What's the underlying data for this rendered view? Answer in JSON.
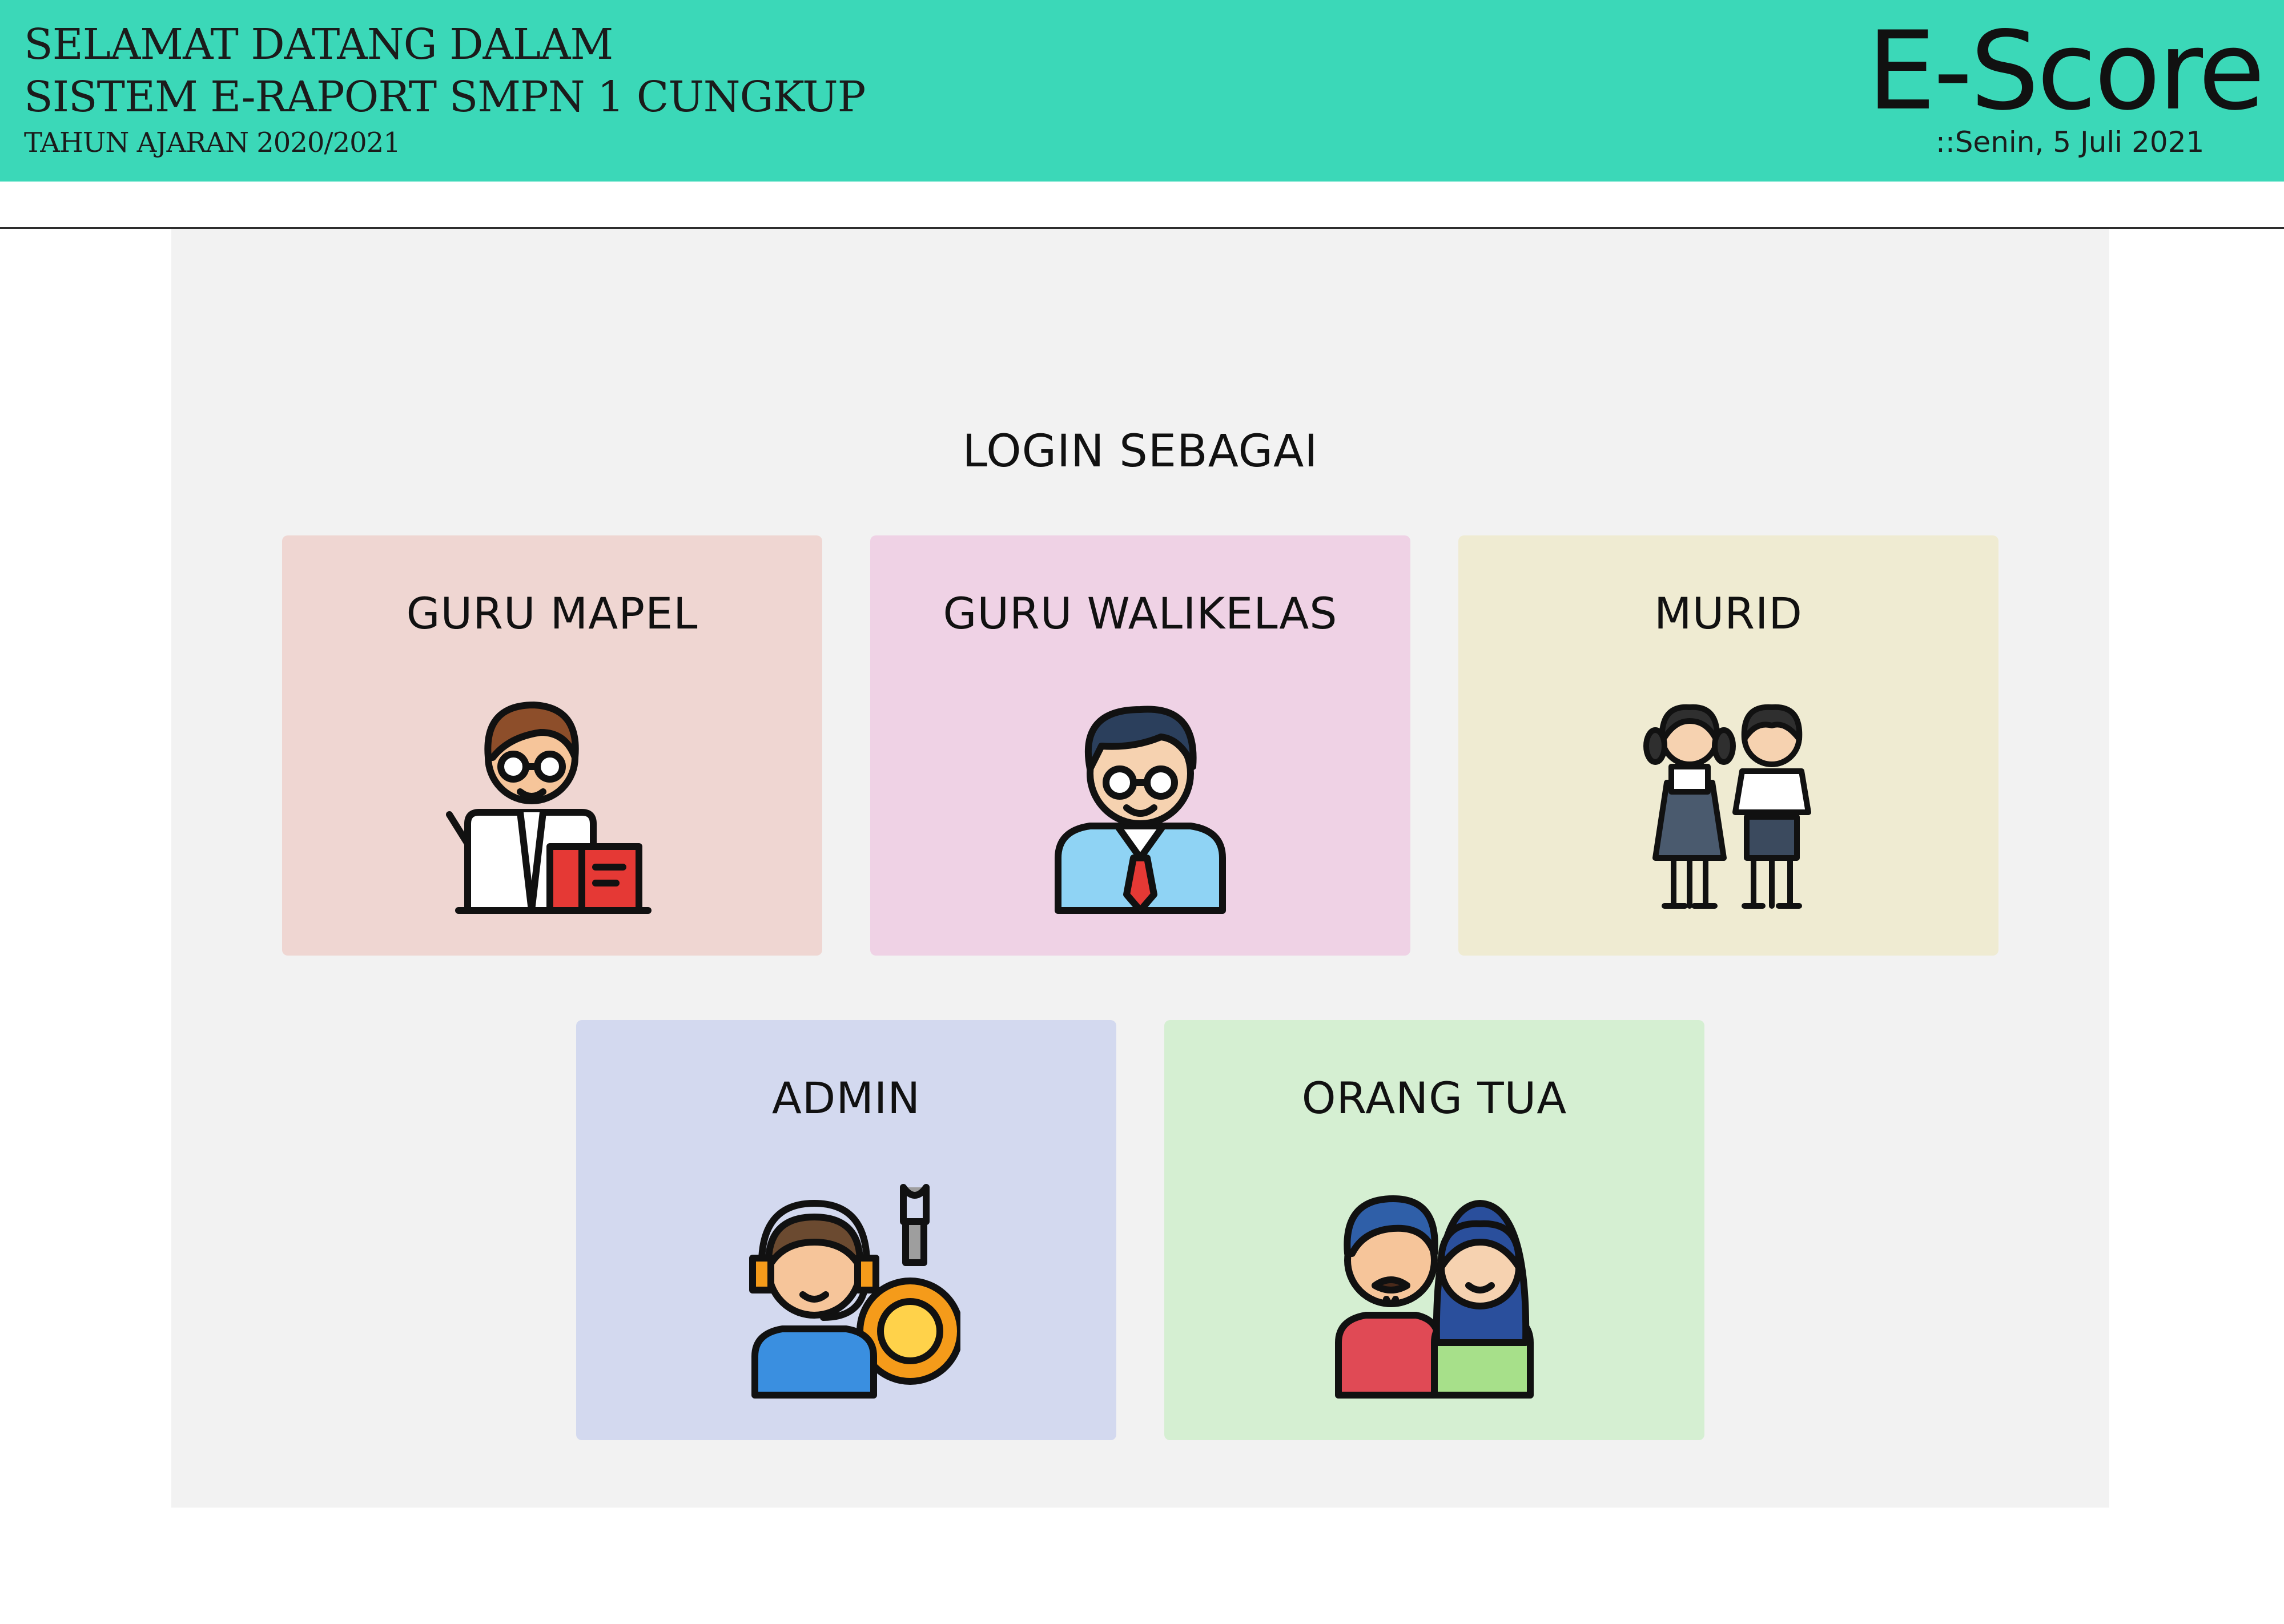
{
  "header": {
    "welcome_line1": "SELAMAT DATANG DALAM",
    "welcome_line2": "SISTEM E-RAPORT SMPN 1 CUNGKUP",
    "school_year": "TAHUN AJARAN 2020/2021",
    "brand": "E-Score",
    "date": "::Senin, 5 Juli 2021",
    "color": "#3bd8b8"
  },
  "login": {
    "title": "LOGIN SEBAGAI",
    "roles": [
      {
        "label": "GURU MAPEL",
        "icon": "teacher-icon",
        "color": "#efd6d2"
      },
      {
        "label": "GURU WALIKELAS",
        "icon": "homeroom-teacher-icon",
        "color": "#efd2e5"
      },
      {
        "label": "MURID",
        "icon": "students-icon",
        "color": "#efebd2"
      },
      {
        "label": "ADMIN",
        "icon": "admin-support-icon",
        "color": "#d3d9ef"
      },
      {
        "label": "ORANG TUA",
        "icon": "parents-icon",
        "color": "#d5efd2"
      }
    ]
  }
}
